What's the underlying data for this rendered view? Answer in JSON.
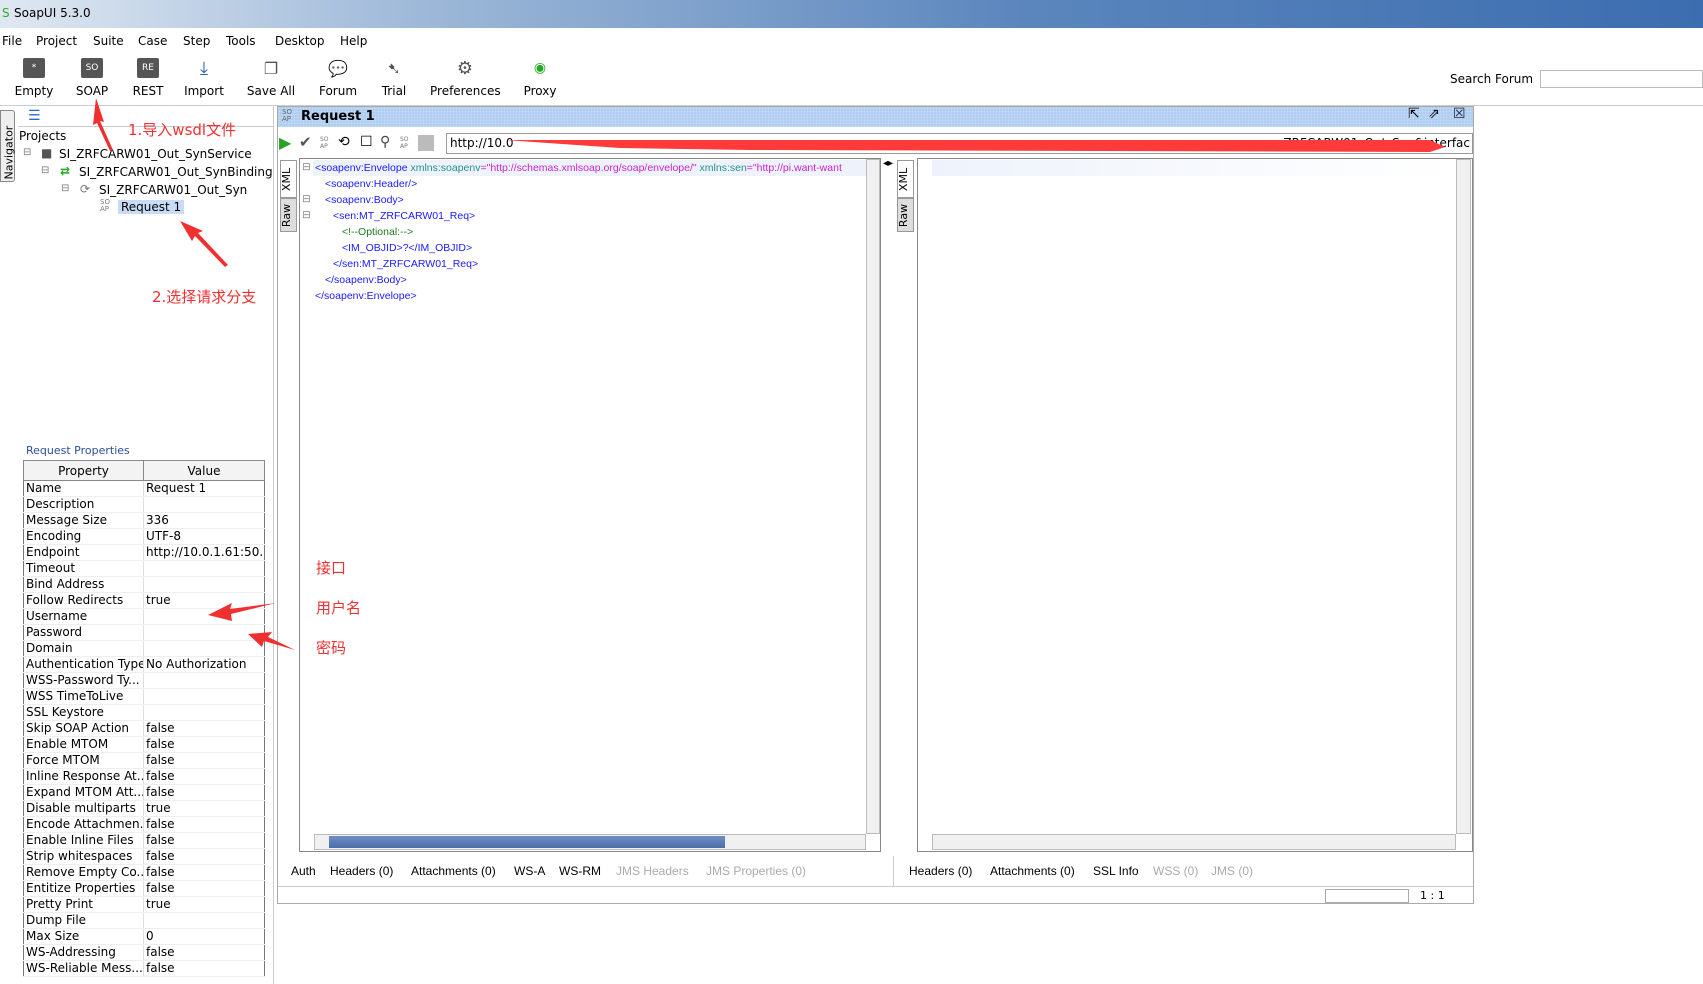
{
  "window": {
    "title": "SoapUI 5.3.0"
  },
  "menu": [
    "File",
    "Project",
    "Suite",
    "Case",
    "Step",
    "Tools",
    "Desktop",
    "Help"
  ],
  "toolbar": [
    "Empty",
    "SOAP",
    "REST",
    "Import",
    "Save All",
    "Forum",
    "Trial",
    "Preferences",
    "Proxy"
  ],
  "search": {
    "label": "Search Forum",
    "value": ""
  },
  "navigator": {
    "tab": "Navigator",
    "root": "Projects",
    "items": [
      "SI_ZRFCARW01_Out_SynService",
      "SI_ZRFCARW01_Out_SynBinding",
      "SI_ZRFCARW01_Out_Syn",
      "Request 1"
    ]
  },
  "properties": {
    "title": "Request Properties",
    "headers": [
      "Property",
      "Value"
    ],
    "rows": [
      [
        "Name",
        "Request 1"
      ],
      [
        "Description",
        ""
      ],
      [
        "Message Size",
        "336"
      ],
      [
        "Encoding",
        "UTF-8"
      ],
      [
        "Endpoint",
        "http://10.0.1.61:50..."
      ],
      [
        "Timeout",
        ""
      ],
      [
        "Bind Address",
        ""
      ],
      [
        "Follow Redirects",
        "true"
      ],
      [
        "Username",
        ""
      ],
      [
        "Password",
        ""
      ],
      [
        "Domain",
        ""
      ],
      [
        "Authentication Type",
        "No Authorization"
      ],
      [
        "WSS-Password Ty...",
        ""
      ],
      [
        "WSS TimeToLive",
        ""
      ],
      [
        "SSL Keystore",
        ""
      ],
      [
        "Skip SOAP Action",
        "false"
      ],
      [
        "Enable MTOM",
        "false"
      ],
      [
        "Force MTOM",
        "false"
      ],
      [
        "Inline Response At...",
        "false"
      ],
      [
        "Expand MTOM Att...",
        "false"
      ],
      [
        "Disable multiparts",
        "true"
      ],
      [
        "Encode Attachmen...",
        "false"
      ],
      [
        "Enable Inline Files",
        "false"
      ],
      [
        "Strip whitespaces",
        "false"
      ],
      [
        "Remove Empty Co...",
        "false"
      ],
      [
        "Entitize Properties",
        "false"
      ],
      [
        "Pretty Print",
        "true"
      ],
      [
        "Dump File",
        ""
      ],
      [
        "Max Size",
        "0"
      ],
      [
        "WS-Addressing",
        "false"
      ],
      [
        "WS-Reliable Mess...",
        "false"
      ]
    ]
  },
  "request": {
    "title": "Request 1",
    "url_start": "http://10.0",
    "url_end": "ZRFCARW01_Out_Syn&interfac",
    "xml": {
      "l1_tag": "<soapenv:Envelope",
      "l1_a1": " xmlns:soapenv",
      "l1_v1": "=\"http://schemas.xmlsoap.org/soap/envelope/\"",
      "l1_a2": " xmlns:sen",
      "l1_v2": "=\"http://pi.want-want",
      "l2": "<soapenv:Header/>",
      "l3": "<soapenv:Body>",
      "l4": "<sen:MT_ZRFCARW01_Req>",
      "l5": "<!--Optional:-->",
      "l6": "<IM_OBJID>?</IM_OBJID>",
      "l7": "</sen:MT_ZRFCARW01_Req>",
      "l8": "</soapenv:Body>",
      "l9": "</soapenv:Envelope>"
    },
    "editor_tabs": [
      "XML",
      "Raw"
    ],
    "bottom_tabs": [
      "Auth",
      "Headers (0)",
      "Attachments (0)",
      "WS-A",
      "WS-RM",
      "JMS Headers",
      "JMS Properties (0)"
    ],
    "response_tabs": [
      "Headers (0)",
      "Attachments (0)",
      "SSL Info",
      "WSS (0)",
      "JMS (0)"
    ],
    "position": "1 : 1"
  },
  "annotations": {
    "step1": "1.导入wsdl文件",
    "step2": "2.选择请求分支",
    "interface": "接口",
    "username": "用户名",
    "password": "密码"
  }
}
